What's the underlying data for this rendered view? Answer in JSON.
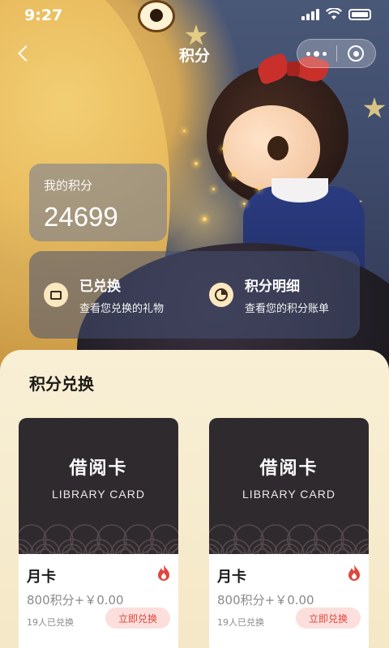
{
  "status_bar": {
    "time": "9:27"
  },
  "nav": {
    "title": "积分",
    "back_icon": "chevron-left-icon",
    "more_icon": "more-dots-icon",
    "close_icon": "target-icon"
  },
  "points": {
    "label": "我的积分",
    "value": "24699"
  },
  "links": [
    {
      "title": "已兑换",
      "subtitle": "查看您兑换的礼物",
      "icon": "ticket-icon"
    },
    {
      "title": "积分明细",
      "subtitle": "查看您的积分账单",
      "icon": "pie-chart-icon"
    }
  ],
  "exchange": {
    "title": "积分兑换",
    "products": [
      {
        "cover_title": "借阅卡",
        "cover_subtitle": "LIBRARY CARD",
        "name": "月卡",
        "price": "800积分+￥0.00",
        "count": "19人已兑换",
        "button": "立即兑换",
        "badge_icon": "fire-icon"
      },
      {
        "cover_title": "借阅卡",
        "cover_subtitle": "LIBRARY CARD",
        "name": "月卡",
        "price": "800积分+￥0.00",
        "count": "19人已兑换",
        "button": "立即兑换",
        "badge_icon": "fire-icon"
      }
    ]
  },
  "colors": {
    "accent": "#e0463c",
    "button_bg": "#fcdfdc",
    "card_dark": "#2f2a2d",
    "sheet_bg": "#f8efd5"
  }
}
